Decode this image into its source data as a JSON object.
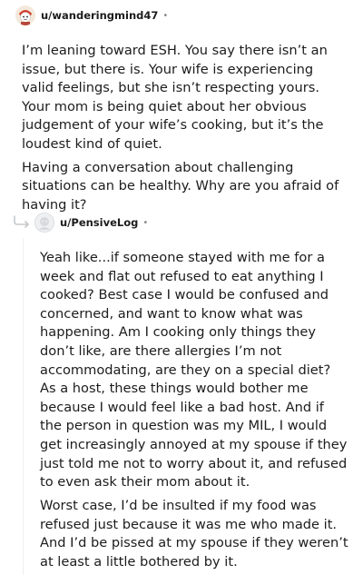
{
  "comment1": {
    "username": "u/wanderingmind47",
    "separator": "•",
    "avatar_icon": "snoo-avatar-icon",
    "paragraphs": [
      "I’m leaning toward ESH. You say there isn’t an issue, but there is. Your wife is experiencing valid feelings, but she isn’t respecting yours. Your mom is being quiet about her obvious judgement of your wife’s cooking, but it’s the loudest kind of quiet.",
      "Having a conversation about challenging situations can be healthy. Why are you afraid of having it?"
    ]
  },
  "comment2": {
    "username": "u/PensiveLog",
    "separator": "•",
    "avatar_icon": "default-avatar-icon",
    "reply_icon": "reply-arrow-icon",
    "paragraphs": [
      "Yeah like...if someone stayed with me for a week and flat out refused to eat anything I cooked? Best case I would be confused and concerned, and want to know what was happening. Am I cooking only things they don’t like, are there allergies I’m not accommodating, are they on a special diet? As a host, these things would bother me because I would feel like a bad host. And if the person in question was my MIL, I would get increasingly annoyed at my spouse if they just told me not to worry about it, and refused to even ask their mom about it.",
      "Worst case, I’d be insulted if my food was refused just because it was me who made it. And I’d be pissed at my spouse if they weren’t at least a little bothered by it."
    ]
  },
  "colors": {
    "text": "#1c1c1c",
    "muted": "#878a8c",
    "thread_line": "#edeff1"
  }
}
